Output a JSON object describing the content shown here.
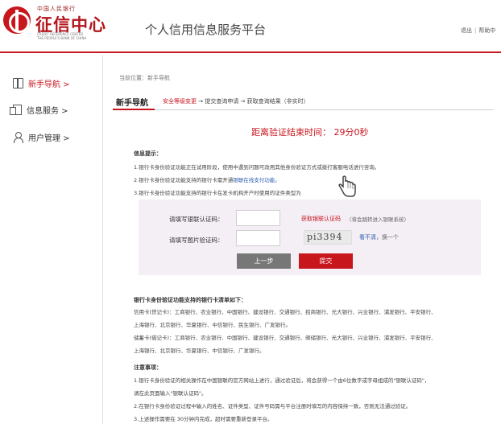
{
  "header": {
    "logo_top": "中国人民银行",
    "logo_main": "征信中心",
    "logo_en_1": "CREDIT REFERENCE CENTER",
    "logo_en_2": "THE PEOPLE'S BANK OF CHINA",
    "platform_title": "个人信用信息服务平台",
    "link_logout": "退出",
    "link_help": "帮助中"
  },
  "sidebar": {
    "items": [
      {
        "label": "新手导航 >",
        "icon": "book-icon",
        "active": true
      },
      {
        "label": "信息服务 >",
        "icon": "document-icon",
        "active": false
      },
      {
        "label": "用户管理 >",
        "icon": "user-icon",
        "active": false
      }
    ]
  },
  "main": {
    "breadcrumb": "当前位置：新手导航",
    "title": "新手导航",
    "steps": {
      "step1": "安全等级变更",
      "step2": "→ 提交查询申请 → 获取查询结果（非实时）"
    },
    "countdown": "距离验证结束时间： 29分0秒",
    "info_heading": "信息提示：",
    "info_lines": [
      "1.银行卡身份验证功能正在试用阶段，使用中遇到问题可改用其他身份验证方式或拨打客服电话进行咨询。",
      "2.银行卡身份验证功能支持的银行卡需开通",
      "3.银行卡身份验证功能支持的银行卡在发卡机构开户时使用的证件类型为"
    ],
    "info_link": "银联在线支付功能。",
    "form": {
      "bank_code_label": "请填写银联认证码：",
      "get_code_link": "获取银联认证码",
      "get_code_hint": "（将会跳转进入银联系统）",
      "captcha_label": "请填写图片验证码：",
      "captcha_text": "pi3394",
      "captcha_refresh_prefix": "看不清",
      "captcha_refresh_suffix": "，换一个",
      "prev_button": "上一步",
      "submit_button": "提交"
    },
    "banks_heading": "银行卡身份验证功能支持的银行卡清单如下：",
    "banks_lines": [
      "信用卡(贷记卡)：工商银行、农业银行、中国银行、建设银行、交通银行、招商银行、光大银行、兴业银行、浦发银行、平安银行、",
      "上海银行、北京银行、华夏银行、中信银行、民生银行、广发银行。",
      "储蓄卡(借记卡)：工商银行、农业银行、中国银行、建设银行、交通银行、邮储银行、光大银行、兴业银行、浦发银行、平安银行、",
      "上海银行、北京银行、华夏银行、中信银行、广发银行。"
    ],
    "notes_heading": "注意事项：",
    "note_lines": [
      "1.银行卡身份验证的相关操作在中国银联的官方网站上进行，通过验证后，将会获得一个由6位数字或字母组成的\"银联认证码\"，",
      "请在此页面输入\"银联认证码\"。",
      "2.在银行卡身份验证过程中输入的姓名、证件类型、证件号码需与平台注册时填写的内容保持一致，否则无法通过验证。",
      "3.上述操作需要在 30分钟内完成，超时需要重新登录平台。"
    ]
  },
  "colors": {
    "brand_red": "#c8161d",
    "link_blue": "#2a5db0",
    "form_background": "#f4eef5"
  }
}
